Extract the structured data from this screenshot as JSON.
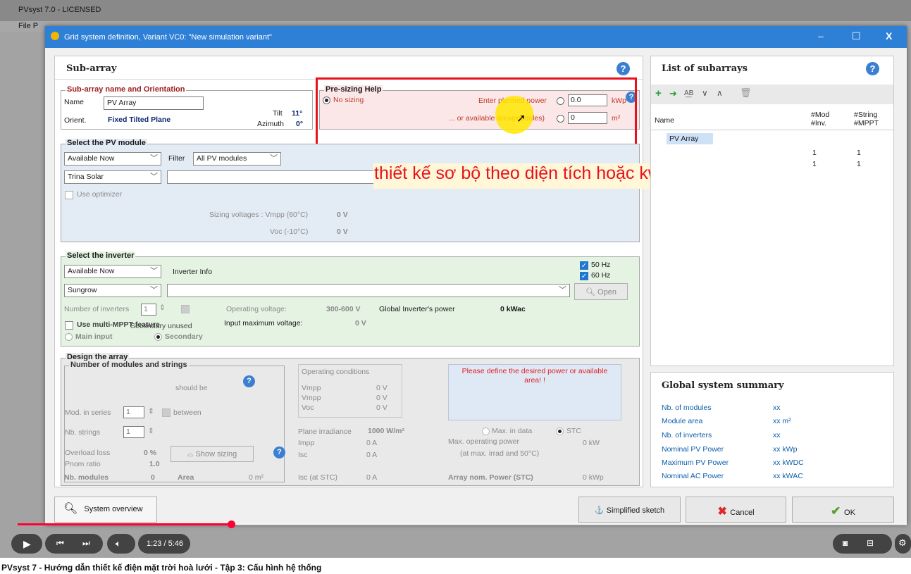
{
  "bg_window": {
    "title": "PVsyst 7.0 - LICENSED",
    "menu": "File  P"
  },
  "dialog": {
    "title": "Grid system definition, Variant VC0:  \"New simulation variant\"",
    "controls": {
      "minimize": "–",
      "maximize": "☐",
      "close": "X"
    }
  },
  "subarray": {
    "header": "Sub-array",
    "name_group": {
      "title": "Sub-array name and Orientation",
      "name_label": "Name",
      "name_value": "PV Array",
      "orient_label": "Orient.",
      "orient_value": "Fixed Tilted Plane",
      "tilt_label": "Tilt",
      "tilt_value": "11°",
      "azimuth_label": "Azimuth",
      "azimuth_value": "0°"
    },
    "presizing": {
      "title": "Pre-sizing Help",
      "no_sizing": "No sizing",
      "planned_power_label": "Enter planned power",
      "planned_power_value": "0.0",
      "planned_power_unit": "kWp",
      "area_label": "... or available area(modules)",
      "area_value": "0",
      "area_unit": "m²"
    },
    "pv_module": {
      "title": "Select the PV module",
      "availability": "Available Now",
      "filter_label": "Filter",
      "filter_value": "All PV modules",
      "manufacturer": "Trina Solar",
      "use_optimizer": "Use optimizer",
      "sizing_voltages_label": "Sizing voltages :  Vmpp (60°C)",
      "vmpp_value": "0 V",
      "voc_label": "Voc  (-10°C)",
      "voc_value": "0 V"
    },
    "inverter": {
      "title": "Select the inverter",
      "availability": "Available Now",
      "info_label": "Inverter Info",
      "hz50": "50 Hz",
      "hz60": "60 Hz",
      "manufacturer": "Sungrow",
      "open_button": "Open",
      "num_inverters_label": "Number of inverters",
      "num_inverters_value": "1",
      "op_voltage_label": "Operating voltage:",
      "op_voltage_value": "300-600 V",
      "global_power_label": "Global Inverter's power",
      "global_power_value": "0  kWac",
      "multi_mppt_label": "Use multi-MPPT feature",
      "secondary_unused": "Secondary unused",
      "input_max_voltage_label": "Input maximum voltage:",
      "input_max_voltage_value": "0 V",
      "main_input": "Main input",
      "secondary": "Secondary"
    },
    "design": {
      "title": "Design the array",
      "num_group_title": "Number of modules and strings",
      "should_be": "should be",
      "mod_series_label": "Mod. in series",
      "mod_series_value": "1",
      "between": "between",
      "nb_strings_label": "Nb. strings",
      "nb_strings_value": "1",
      "overload_label": "Overload loss",
      "overload_value": "0 %",
      "pnom_label": "Pnom ratio",
      "pnom_value": "1.0",
      "show_sizing": "Show sizing",
      "nb_modules_label": "Nb. modules",
      "nb_modules_value": "0",
      "area_label": "Area",
      "area_value": "0 m²",
      "op_conditions_title": "Operating conditions",
      "op_rows": [
        {
          "label": "Vmpp",
          "value": "0 V"
        },
        {
          "label": "Vmpp",
          "value": "0 V"
        },
        {
          "label": "Voc",
          "value": "0 V"
        }
      ],
      "plane_irr_label": "Plane irradiance",
      "plane_irr_value": "1000 W/m²",
      "max_in_data": "Max. in data",
      "stc": "STC",
      "impp_label": "Impp",
      "impp_value": "0 A",
      "isc_label": "Isc",
      "isc_value": "0 A",
      "max_op_power_label": "Max. operating power",
      "max_op_power_sub": "(at max. irrad and 50°C)",
      "max_op_power_value": "0 kW",
      "isc_stc_label": "Isc (at STC)",
      "isc_stc_value": "0 A",
      "array_nom_label": "Array nom. Power (STC)",
      "array_nom_value": "0 kWp",
      "warning": "Please define the desired power or available area! !"
    }
  },
  "subarray_list": {
    "header": "List of subarrays",
    "columns": [
      "Name",
      "#Mod\n#Inv.",
      "#String\n#MPPT"
    ],
    "rows": [
      {
        "name": "PV Array",
        "mod": "",
        "string": ""
      },
      {
        "name": "",
        "mod": "1",
        "string": "1"
      },
      {
        "name": "",
        "mod": "1",
        "string": "1"
      }
    ]
  },
  "summary": {
    "header": "Global system summary",
    "rows": [
      {
        "label": "Nb. of modules",
        "value": "xx"
      },
      {
        "label": "Module area",
        "value": "xx m²"
      },
      {
        "label": "Nb. of inverters",
        "value": "xx"
      },
      {
        "label": "Nominal PV Power",
        "value": "xx  kWp"
      },
      {
        "label": "Maximum PV Power",
        "value": "xx  kWDC"
      },
      {
        "label": "Nominal AC Power",
        "value": "xx  kWAC"
      }
    ]
  },
  "footer": {
    "system_overview": "System overview",
    "simplified_sketch": "Simplified sketch",
    "cancel": "Cancel",
    "ok": "OK"
  },
  "annotation": "thiết kế sơ bộ theo diện tích hoặc kwp",
  "player": {
    "time": "1:23 / 5:46",
    "progress": 0.24
  },
  "video_title": "PVsyst 7 - Hướng dẫn thiết kế điện mặt trời hoà lưới - Tập 3: Cấu hình hệ thống",
  "colors": {
    "accent": "#2e7fd6",
    "highlight_red": "#e8121c",
    "annotation_text": "#e8121c",
    "progress": "#ff0033"
  }
}
